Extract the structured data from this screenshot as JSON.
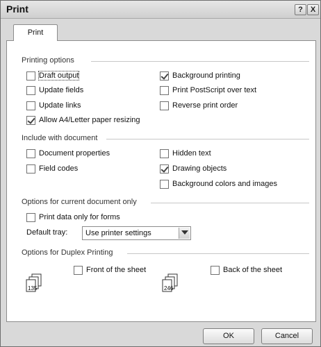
{
  "window": {
    "title": "Print",
    "help_glyph": "?",
    "close_glyph": "X"
  },
  "tab": {
    "label": "Print"
  },
  "printing_options": {
    "heading": "Printing options",
    "left": [
      {
        "label": "Draft output",
        "checked": false
      },
      {
        "label": "Update fields",
        "checked": false
      },
      {
        "label": "Update links",
        "checked": false
      },
      {
        "label": "Allow A4/Letter paper resizing",
        "checked": true
      }
    ],
    "right": [
      {
        "label": "Background printing",
        "checked": true
      },
      {
        "label": "Print PostScript over text",
        "checked": false
      },
      {
        "label": "Reverse print order",
        "checked": false
      }
    ]
  },
  "include_with_document": {
    "heading": "Include with document",
    "left": [
      {
        "label": "Document properties",
        "checked": false
      },
      {
        "label": "Field codes",
        "checked": false
      }
    ],
    "right": [
      {
        "label": "Hidden text",
        "checked": false
      },
      {
        "label": "Drawing objects",
        "checked": true
      },
      {
        "label": "Background colors and images",
        "checked": false
      }
    ]
  },
  "current_document": {
    "heading": "Options for current document only",
    "print_data_only": {
      "label": "Print data only for forms",
      "checked": false
    },
    "default_tray_label": "Default tray:",
    "default_tray_value": "Use printer settings"
  },
  "duplex": {
    "heading": "Options for Duplex Printing",
    "front": {
      "label": "Front of the sheet",
      "checked": false,
      "icon_digits": "135"
    },
    "back": {
      "label": "Back of the sheet",
      "checked": false,
      "icon_digits": "246"
    }
  },
  "buttons": {
    "ok": "OK",
    "cancel": "Cancel"
  }
}
